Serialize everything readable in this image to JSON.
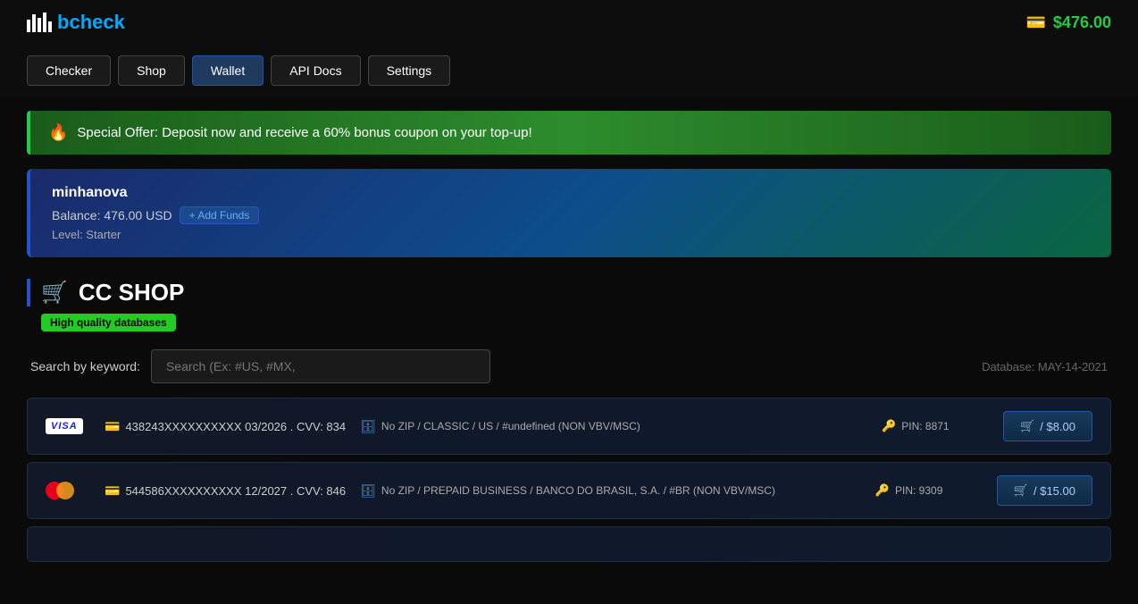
{
  "header": {
    "logo_bars": [
      14,
      20,
      16,
      22,
      12
    ],
    "logo_b": "b",
    "logo_check": "check",
    "wallet_icon": "💳",
    "balance": "$476.00"
  },
  "nav": {
    "items": [
      {
        "label": "Checker",
        "active": false
      },
      {
        "label": "Shop",
        "active": false
      },
      {
        "label": "Wallet",
        "active": true
      },
      {
        "label": "API Docs",
        "active": false
      },
      {
        "label": "Settings",
        "active": false
      }
    ]
  },
  "offer_banner": {
    "icon": "🔥",
    "text": "Special Offer: Deposit now and receive a 60% bonus coupon on your top-up!"
  },
  "user_card": {
    "username": "minhanova",
    "balance_label": "Balance: 476.00 USD",
    "add_funds_label": "+ Add Funds",
    "level_label": "Level: Starter"
  },
  "shop": {
    "cart_icon": "🛒",
    "title": "CC SHOP",
    "quality_badge": "High quality databases",
    "search_label": "Search by keyword:",
    "search_placeholder": "Search (Ex: #US, #MX,",
    "database_label": "Database: MAY-14-2021"
  },
  "cards": [
    {
      "brand": "VISA",
      "brand_type": "visa",
      "number": "438243XXXXXXXXXX 03/2026 . CVV: 834",
      "info": "No ZIP / CLASSIC / US / #undefined (NON VBV/MSC)",
      "pin": "PIN: 8871",
      "price": "/ $8.00"
    },
    {
      "brand": "MC",
      "brand_type": "mastercard",
      "number": "544586XXXXXXXXXX 12/2027 . CVV: 846",
      "info": "No ZIP / PREPAID BUSINESS / BANCO DO BRASIL, S.A. / #BR (NON VBV/MSC)",
      "pin": "PIN: 9309",
      "price": "/ $15.00"
    }
  ],
  "icons": {
    "credit_card": "💳",
    "cart": "🛒",
    "key": "🔑",
    "database": "🗄️",
    "fire": "🔥"
  }
}
